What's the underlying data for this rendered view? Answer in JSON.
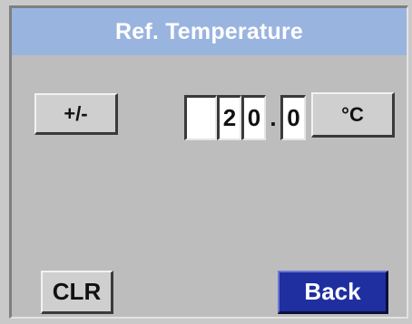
{
  "dialog": {
    "title": "Ref. Temperature"
  },
  "controls": {
    "sign_label": "+/-",
    "unit_label": "°C",
    "clear_label": "CLR",
    "back_label": "Back"
  },
  "value": {
    "digits": [
      "",
      "2",
      "0",
      "0"
    ],
    "decimal_separator": "."
  },
  "colors": {
    "title_bar": "#9ab4e0",
    "back_button": "#1f2fa0",
    "panel": "#bdbdbd"
  }
}
